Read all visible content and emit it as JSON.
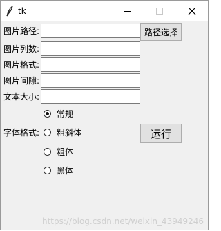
{
  "window": {
    "title": "tk",
    "controls": {
      "minimize": "minimize",
      "maximize": "maximize",
      "close": "close"
    }
  },
  "form": {
    "image_path_label": "图片路径:",
    "image_path_value": "",
    "path_select_button": "路径选择",
    "columns_label": "图片列数:",
    "columns_value": "",
    "format_label": "图片格式:",
    "format_value": "",
    "gap_label": "图片间隙:",
    "gap_value": "",
    "text_size_label": "文本大小:",
    "text_size_value": "",
    "font_style_label": "字体格式:",
    "font_options": [
      {
        "label": "常规",
        "checked": true
      },
      {
        "label": "粗斜体",
        "checked": false
      },
      {
        "label": "粗体",
        "checked": false
      },
      {
        "label": "黑体",
        "checked": false
      }
    ],
    "run_button": "运行"
  },
  "watermark": "https://blog.csdn.net/weixin_43949246",
  "icons": [
    "feather-icon",
    "minimize-icon",
    "maximize-icon",
    "close-icon",
    "radio-icon"
  ],
  "colors": {
    "window_bg": "#f0f0f0",
    "titlebar_bg": "#ffffff",
    "button_bg": "#e1e1e1"
  }
}
